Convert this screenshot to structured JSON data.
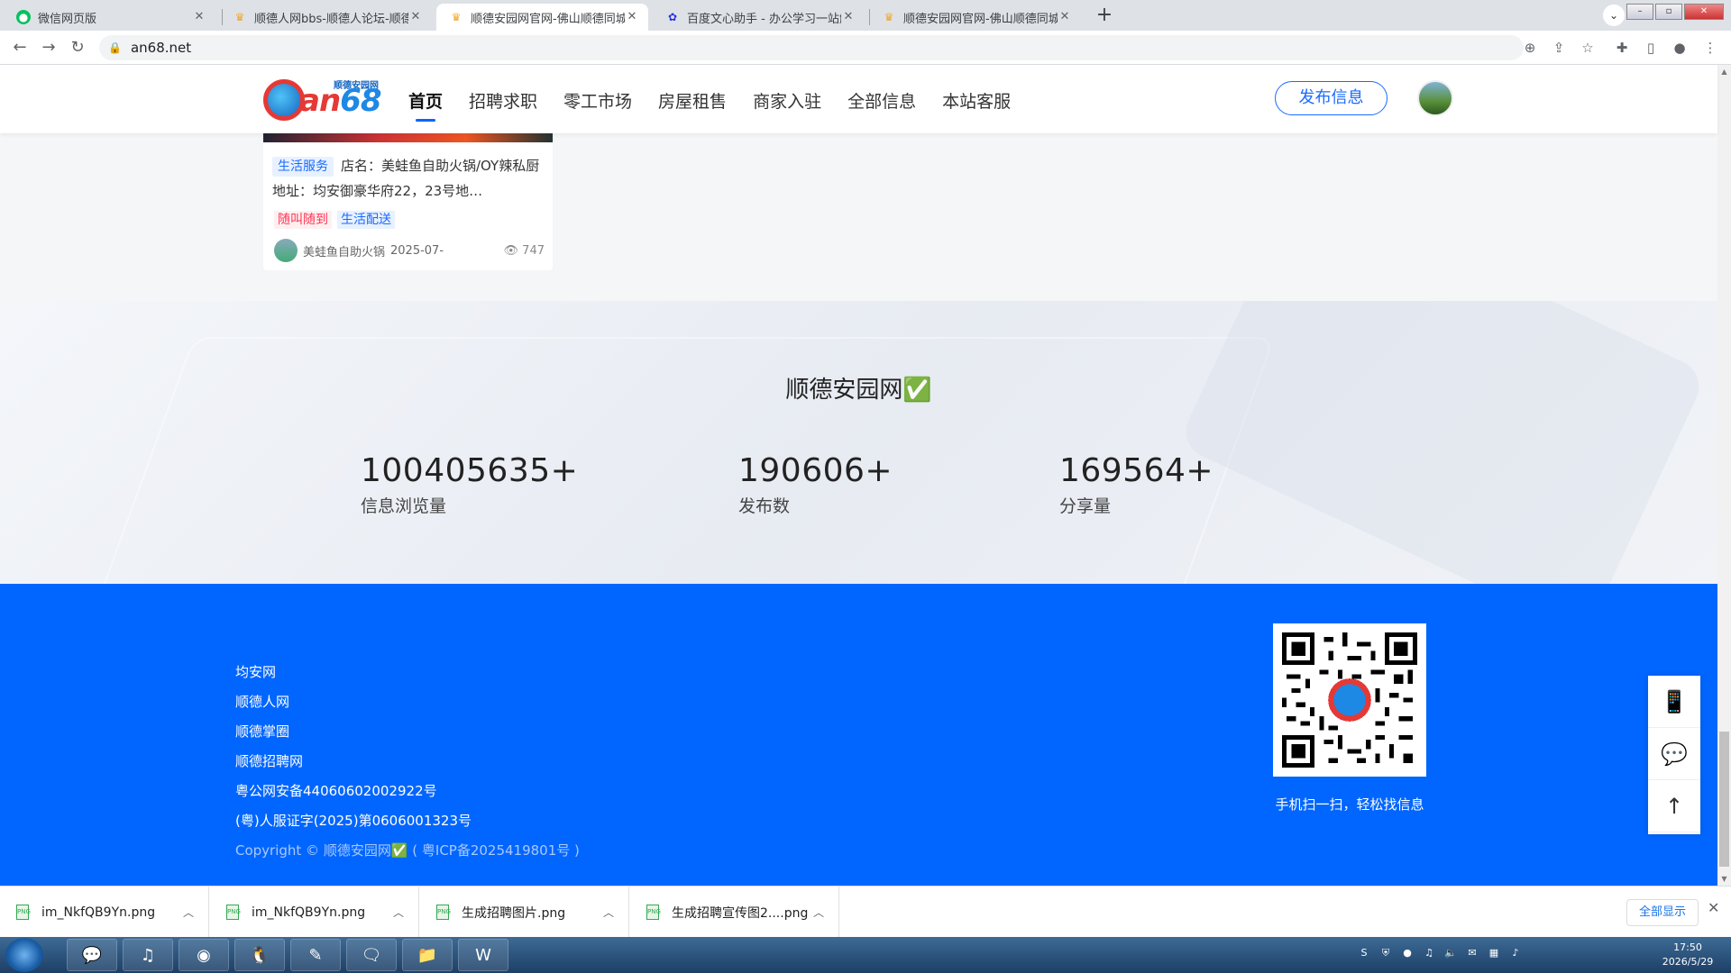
{
  "browser": {
    "tabs": [
      {
        "title": "微信网页版",
        "active": false,
        "icon": "wechat-icon",
        "color": "#07c160"
      },
      {
        "title": "顺德人网bbs-顺德人论坛-顺德人",
        "active": false,
        "icon": "site-favicon-icon",
        "color": "#f5a623"
      },
      {
        "title": "顺德安园网官网-佛山顺德同城门",
        "active": true,
        "icon": "site-favicon-icon",
        "color": "#f5a623"
      },
      {
        "title": "百度文心助手 - 办公学习一站解",
        "active": false,
        "icon": "baidu-paw-icon",
        "color": "#2932e1"
      },
      {
        "title": "顺德安园网官网-佛山顺德同城门",
        "active": false,
        "icon": "site-favicon-icon",
        "color": "#f5a623"
      }
    ],
    "url": "an68.net"
  },
  "site": {
    "logo_small": "顺德安园网",
    "logo_main_a": "an",
    "logo_main_b": "68",
    "nav": [
      "首页",
      "招聘求职",
      "零工市场",
      "房屋租售",
      "商家入驻",
      "全部信息",
      "本站客服"
    ],
    "publish_label": "发布信息"
  },
  "card": {
    "category": "生活服务",
    "text": "店名：美蛙鱼自助火锅/OY辣私厨 地址：均安御豪华府22，23号地…",
    "tags": [
      "随叫随到",
      "生活配送"
    ],
    "author": "美蛙鱼自助火锅",
    "date": "2025-07-",
    "views": "747"
  },
  "stats": {
    "title": "顺德安园网✅",
    "items": [
      {
        "num": "100405635+",
        "label": "信息浏览量"
      },
      {
        "num": "190606+",
        "label": "发布数"
      },
      {
        "num": "169564+",
        "label": "分享量"
      }
    ]
  },
  "footer": {
    "links": [
      "均安网",
      "顺德人网",
      "顺德掌圈",
      "顺德招聘网",
      "粤公网安备44060602002922号",
      "(粤)人服证字(2025)第0606001323号"
    ],
    "copyright": "Copyright © 顺德安园网✅ ( 粤ICP备2025419801号 )",
    "qr_caption": "手机扫一扫，轻松找信息"
  },
  "downloads": {
    "items": [
      "im_NkfQB9Yn.png",
      "im_NkfQB9Yn.png",
      "生成招聘图片.png",
      "生成招聘宣传图2....png"
    ],
    "show_all": "全部显示"
  },
  "taskbar": {
    "time": "17:50",
    "date": "2026/5/29"
  },
  "colors": {
    "brand_blue": "#0066ff",
    "accent_red": "#e53935"
  }
}
